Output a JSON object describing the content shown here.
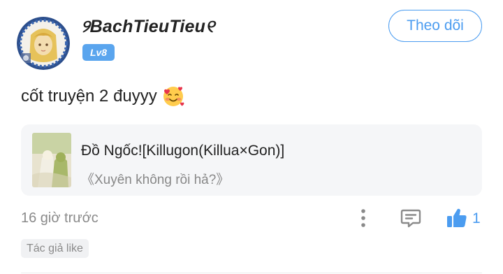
{
  "comment": {
    "username": "୨BachTieuTieu୧",
    "level_badge": "Lv8",
    "follow_label": "Theo dõi",
    "text": "cốt truyện 2 đuyyy",
    "emoji": "smiling-face-with-hearts-emoji",
    "timestamp": "16 giờ trước",
    "like_count": "1",
    "author_like_tag": "Tác giả like"
  },
  "linked_story": {
    "title": "Đồ Ngốc![Killugon(Killua×Gon)]",
    "chapter": "《Xuyên không rồi hả?》"
  },
  "icons": {
    "more": "more-vertical-icon",
    "reply": "comment-reply-icon",
    "like": "thumbs-up-icon"
  },
  "colors": {
    "accent": "#4b9cf0",
    "badge": "#5aa5ee",
    "card_background": "#f5f6f8",
    "muted_text": "#8a8a8a"
  }
}
